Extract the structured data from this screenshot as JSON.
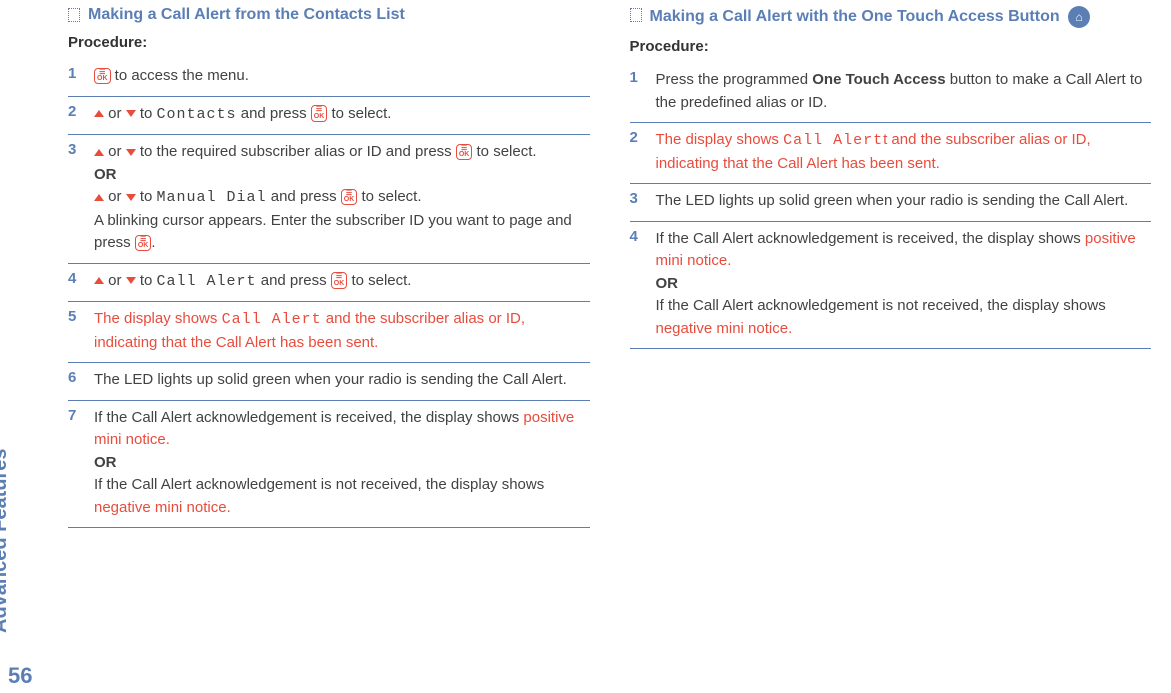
{
  "side_label": "Advanced Features",
  "page_number": "56",
  "left": {
    "heading": "Making a Call Alert from the Contacts List",
    "procedure_label": "Procedure:",
    "steps": {
      "n1": "1",
      "s1_a": " to access the menu.",
      "n2": "2",
      "s2_a": " or ",
      "s2_b": " to ",
      "s2_contacts": "Contacts",
      "s2_c": " and press ",
      "s2_d": " to select.",
      "n3": "3",
      "s3_a": " or ",
      "s3_b": " to the required subscriber alias or ID and press ",
      "s3_c": " to select.",
      "s3_or": "OR",
      "s3_d": " or ",
      "s3_e": " to ",
      "s3_manual": "Manual Dial",
      "s3_f": " and press ",
      "s3_g": " to select.",
      "s3_h": "A blinking cursor appears. Enter the subscriber ID you want to page and press ",
      "s3_i": ".",
      "n4": "4",
      "s4_a": " or ",
      "s4_b": " to ",
      "s4_call_alert": "Call Alert",
      "s4_c": " and press ",
      "s4_d": " to select.",
      "n5": "5",
      "s5_a": "The display shows ",
      "s5_call_alert": "Call Alert",
      "s5_b": " and the subscriber alias or ID, indicating that the Call Alert has been sent.",
      "n6": "6",
      "s6": "The LED lights up solid green when your radio is sending the Call Alert.",
      "n7": "7",
      "s7_a": "If the Call Alert acknowledgement is received, the display shows  ",
      "s7_pos": "positive mini notice.",
      "s7_or": "OR",
      "s7_b": "If the Call Alert acknowledgement is not received, the display shows  ",
      "s7_neg": "negative mini notice."
    }
  },
  "right": {
    "heading": "Making a Call Alert with the One Touch Access Button ",
    "procedure_label": "Procedure:",
    "steps": {
      "n1": "1",
      "s1_a": "Press the programmed ",
      "s1_bold": "One Touch Access",
      "s1_b": " button to make a Call Alert to the predefined alias or ID.",
      "n2": "2",
      "s2_a": "The display shows ",
      "s2_call_alert": "Call Alert",
      "s2_b": "t and the subscriber alias or ID, indicating that the Call Alert has been sent.",
      "n3": "3",
      "s3": "The LED lights up solid green when your radio is sending the Call Alert.",
      "n4": "4",
      "s4_a": "If the Call Alert acknowledgement is received, the display shows  ",
      "s4_pos": "positive mini notice.",
      "s4_or": "OR",
      "s4_b": "If the Call Alert acknowledgement is not received, the display shows  ",
      "s4_neg": "negative mini notice."
    }
  },
  "icons": {
    "ok_top": "☰",
    "ok_bottom": "OK",
    "ota": "⌂"
  }
}
